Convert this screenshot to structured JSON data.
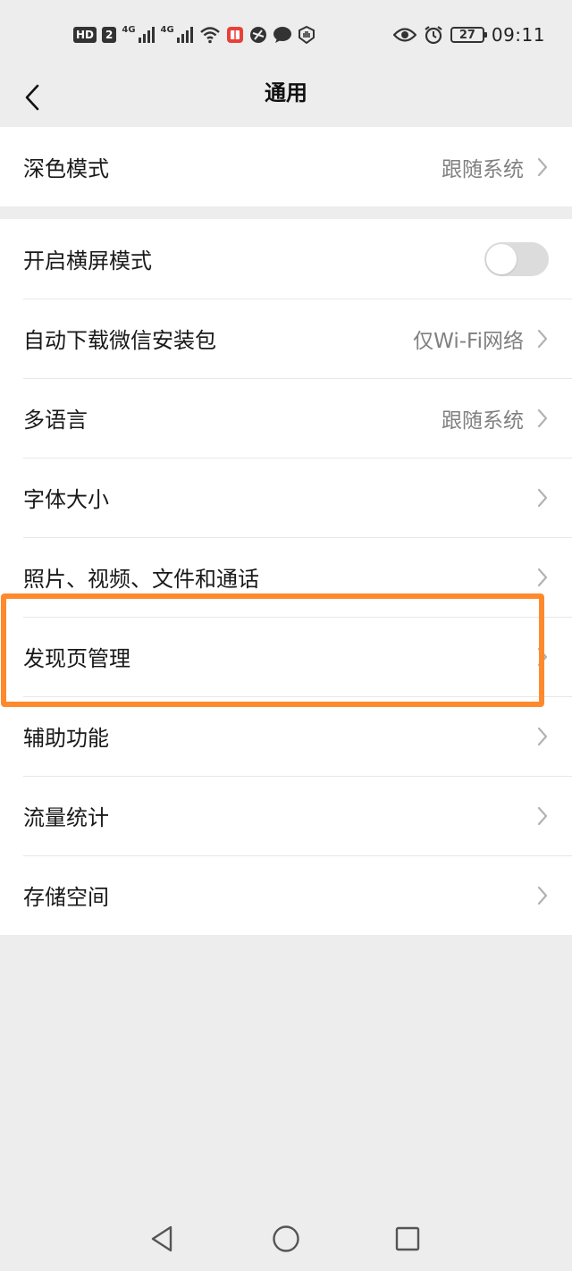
{
  "status_bar": {
    "time": "09:11",
    "battery": "27",
    "network_badge": "HD",
    "network_sub": "2",
    "signal_1": "4G",
    "signal_2": "4G"
  },
  "nav": {
    "title": "通用"
  },
  "settings": {
    "dark_mode": {
      "label": "深色模式",
      "value": "跟随系统"
    },
    "items": [
      {
        "label": "开启横屏模式",
        "type": "toggle",
        "on": false
      },
      {
        "label": "自动下载微信安装包",
        "value": "仅Wi-Fi网络"
      },
      {
        "label": "多语言",
        "value": "跟随系统"
      },
      {
        "label": "字体大小"
      },
      {
        "label": "照片、视频、文件和通话"
      },
      {
        "label": "发现页管理"
      },
      {
        "label": "辅助功能"
      },
      {
        "label": "流量统计"
      },
      {
        "label": "存储空间"
      }
    ]
  },
  "colors": {
    "background": "#ededed",
    "highlight": "#ff8a2d",
    "secondary_text": "#808080"
  },
  "icons": {
    "back": "chevron-left-icon",
    "row_arrow": "chevron-right-icon",
    "sys_back": "triangle-back-icon",
    "sys_home": "circle-home-icon",
    "sys_recent": "square-recent-icon"
  }
}
